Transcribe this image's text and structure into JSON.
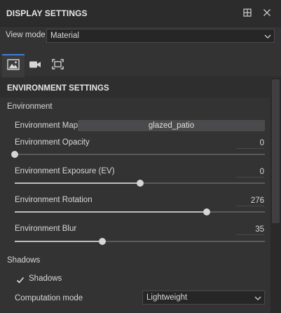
{
  "panel": {
    "title": "DISPLAY SETTINGS",
    "icons": [
      "dock-icon",
      "close-icon"
    ]
  },
  "view_mode": {
    "label": "View mode",
    "value": "Material"
  },
  "tabs": [
    {
      "icon": "image-icon",
      "active": true
    },
    {
      "icon": "camera-icon",
      "active": false
    },
    {
      "icon": "frame-icon",
      "active": false
    }
  ],
  "section": {
    "title": "ENVIRONMENT SETTINGS"
  },
  "environment": {
    "group_label": "Environment",
    "map_label": "Environment Map",
    "map_value": "glazed_patio",
    "opacity": {
      "label": "Environment Opacity",
      "value": "0",
      "fraction": 0.0
    },
    "exposure": {
      "label": "Environment Exposure (EV)",
      "value": "0",
      "fraction": 0.5
    },
    "rotation": {
      "label": "Environment Rotation",
      "value": "276",
      "fraction": 0.7667
    },
    "blur": {
      "label": "Environment Blur",
      "value": "35",
      "fraction": 0.35
    }
  },
  "shadows": {
    "group_label": "Shadows",
    "checkbox_label": "Shadows",
    "checked": true,
    "computation_label": "Computation mode",
    "computation_value": "Lightweight"
  },
  "colors": {
    "accent": "#3b7dd8",
    "background": "#333334"
  }
}
